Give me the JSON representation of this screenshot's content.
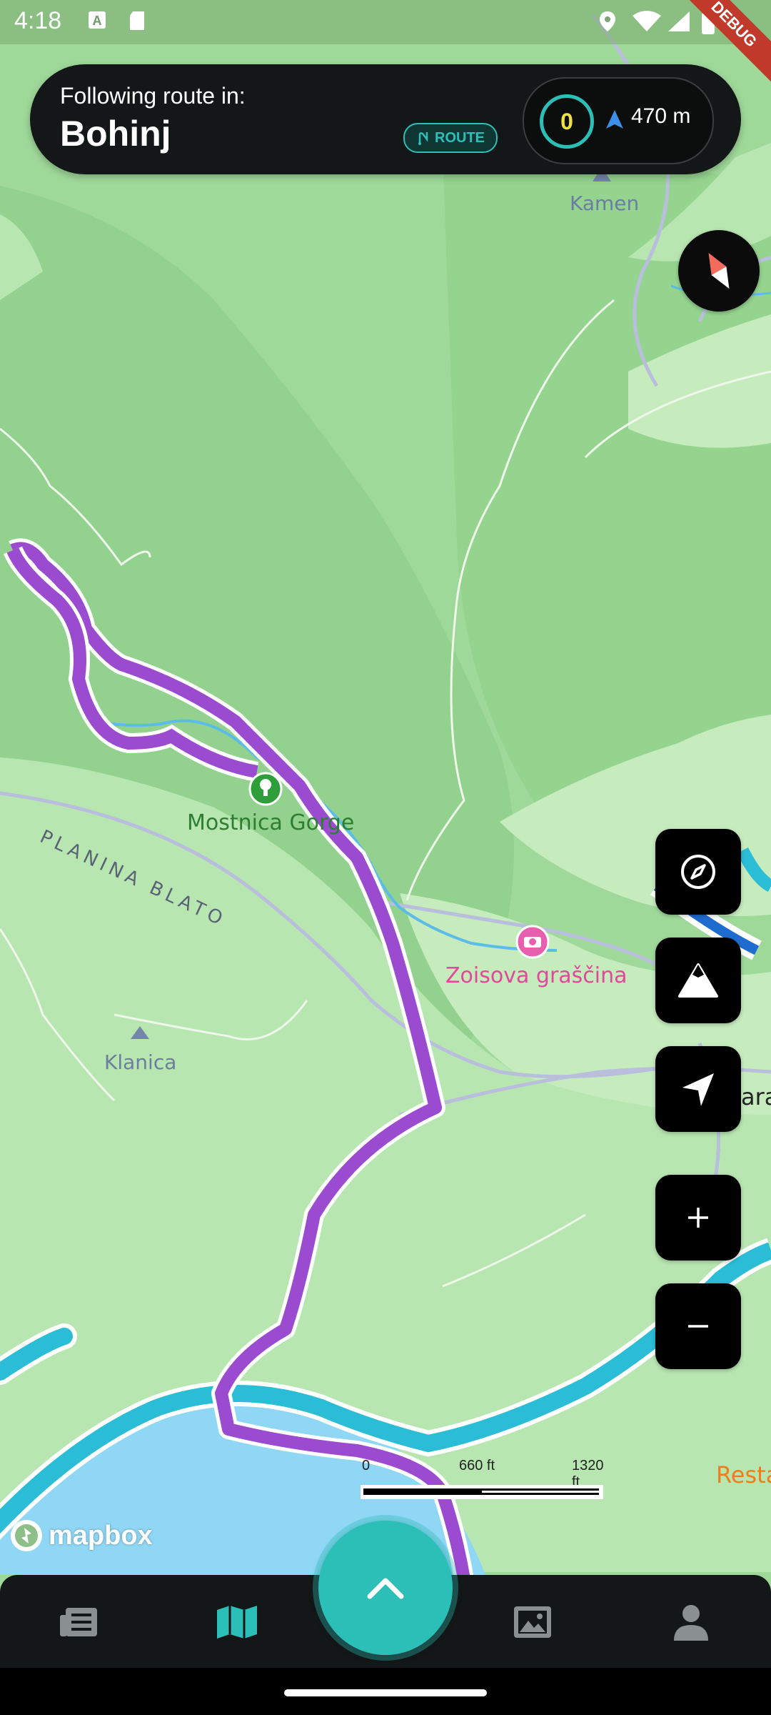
{
  "status_bar": {
    "time": "4:18",
    "debug": "DEBUG",
    "icons": [
      "font-icon",
      "sd-card-icon",
      "location-icon",
      "wifi-icon",
      "signal-icon",
      "battery-icon"
    ]
  },
  "route_card": {
    "label": "Following route in:",
    "name": "Bohinj",
    "badge": "ROUTE",
    "counter": "0",
    "distance": "470 m"
  },
  "map": {
    "labels": {
      "kamen": "Kamen",
      "mostnica": "Mostnica Gorge",
      "planina": "PLANINA BLATO",
      "zoisova": "Zoisova graščina",
      "klanica": "Klanica",
      "ara": "ara",
      "restaurant": "Resta"
    },
    "scale": {
      "zero": "0",
      "mid": "660 ft",
      "end": "1320 ft"
    },
    "attribution": "mapbox",
    "colors": {
      "land": "#9fd99a",
      "forest": "#8fcf8a",
      "route": "#9b4bcf",
      "water": "#8fd7f5",
      "road": "#2bbcd6"
    }
  },
  "controls": [
    "compass-button",
    "terrain-button",
    "recenter-button",
    "zoom-in-button",
    "zoom-out-button"
  ],
  "bottom_nav": {
    "items": [
      "news-icon",
      "map-icon",
      "expand-fab",
      "gallery-icon",
      "profile-icon"
    ],
    "active": "map-icon",
    "accent": "#2bbfb7"
  }
}
